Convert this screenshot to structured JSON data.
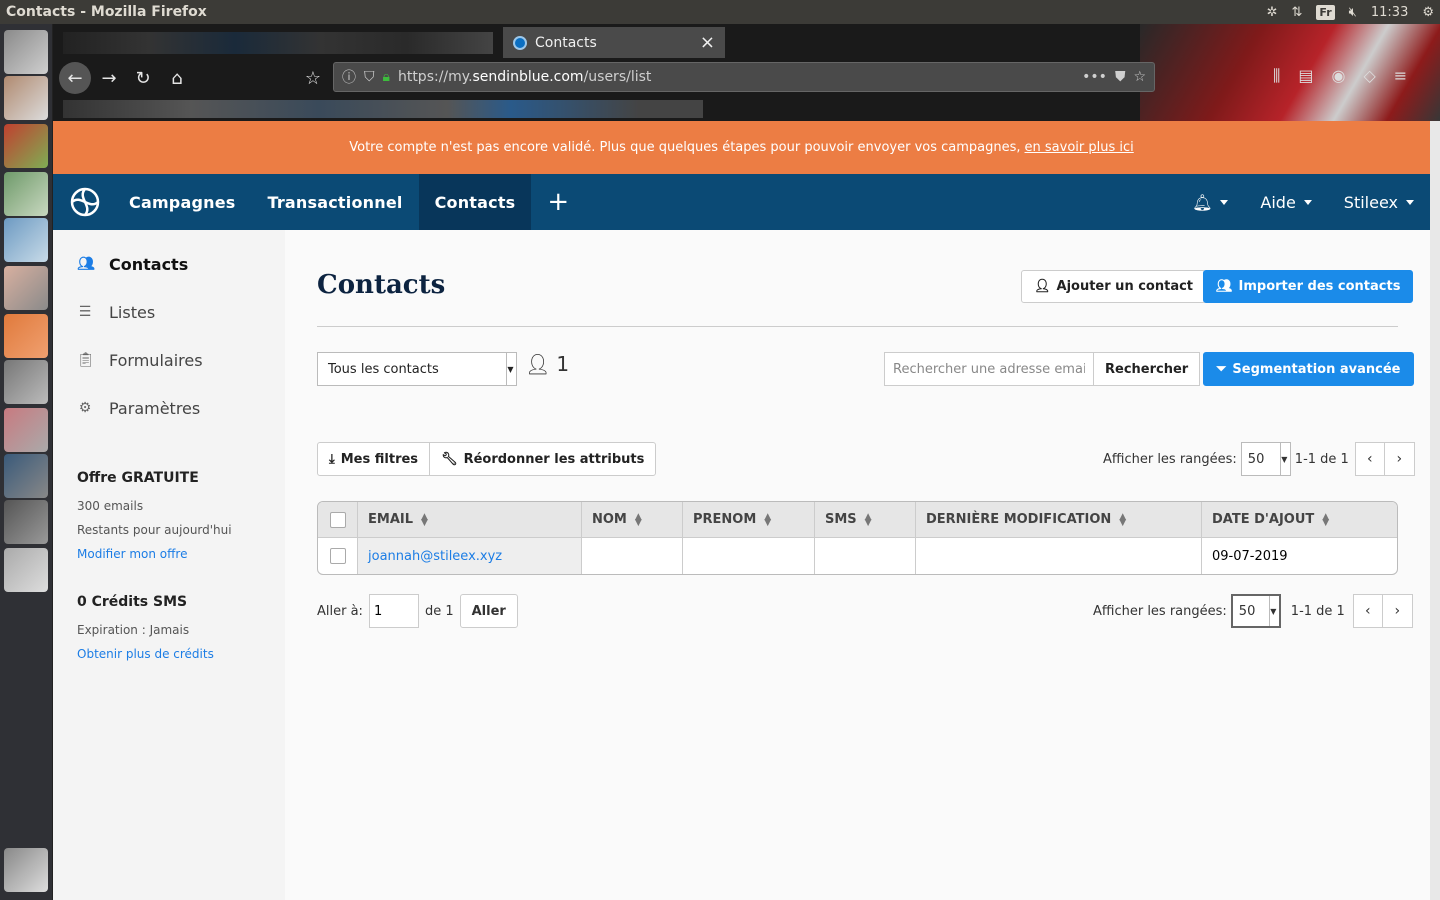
{
  "os": {
    "window_title": "Contacts - Mozilla Firefox",
    "keyboard_layout": "Fr",
    "clock": "11:33"
  },
  "browser": {
    "tab_title": "Contacts",
    "url_prefix": "https://my.",
    "url_host": "sendinblue.com",
    "url_path": "/users/list"
  },
  "banner": {
    "text": "Votre compte n'est pas encore validé. Plus que quelques étapes pour pouvoir envoyer vos campagnes,",
    "link": "en savoir plus ici"
  },
  "appnav": {
    "items": [
      "Campagnes",
      "Transactionnel",
      "Contacts"
    ],
    "active": "Contacts",
    "help": "Aide",
    "user": "Stileex"
  },
  "sidebar": {
    "items": [
      {
        "label": "Contacts",
        "icon": "users-icon",
        "active": true
      },
      {
        "label": "Listes",
        "icon": "list-icon",
        "active": false
      },
      {
        "label": "Formulaires",
        "icon": "clipboard-icon",
        "active": false
      },
      {
        "label": "Paramètres",
        "icon": "gear-icon",
        "active": false
      }
    ],
    "plan": {
      "title": "Offre GRATUITE",
      "emails": "300 emails",
      "remaining": "Restants pour aujourd'hui",
      "link": "Modifier mon offre"
    },
    "sms": {
      "title": "0 Crédits SMS",
      "expiry": "Expiration : Jamais",
      "link": "Obtenir plus de crédits"
    }
  },
  "main": {
    "title": "Contacts",
    "add_contact": "Ajouter un contact",
    "import_contacts": "Importer des contacts",
    "filter_select": "Tous les contacts",
    "contact_count": "1",
    "search_placeholder": "Rechercher une adresse email",
    "search_button": "Rechercher",
    "segmentation": "Segmentation avancée",
    "my_filters": "Mes filtres",
    "reorder": "Réordonner les attributs",
    "rows_label": "Afficher les rangées:",
    "rows_value": "50",
    "range": "1-1 de 1",
    "goto_label": "Aller à:",
    "goto_value": "1",
    "goto_of": "de 1",
    "goto_button": "Aller"
  },
  "table": {
    "columns": [
      "EMAIL",
      "NOM",
      "PRENOM",
      "SMS",
      "DERNIÈRE MODIFICATION",
      "DATE D'AJOUT"
    ],
    "rows": [
      [
        "joannah@stileex.xyz",
        "",
        "",
        "",
        "",
        "09-07-2019"
      ]
    ]
  },
  "colors": {
    "banner": "#ec7d44",
    "nav": "#0b4a75",
    "primary": "#1b8be9"
  }
}
